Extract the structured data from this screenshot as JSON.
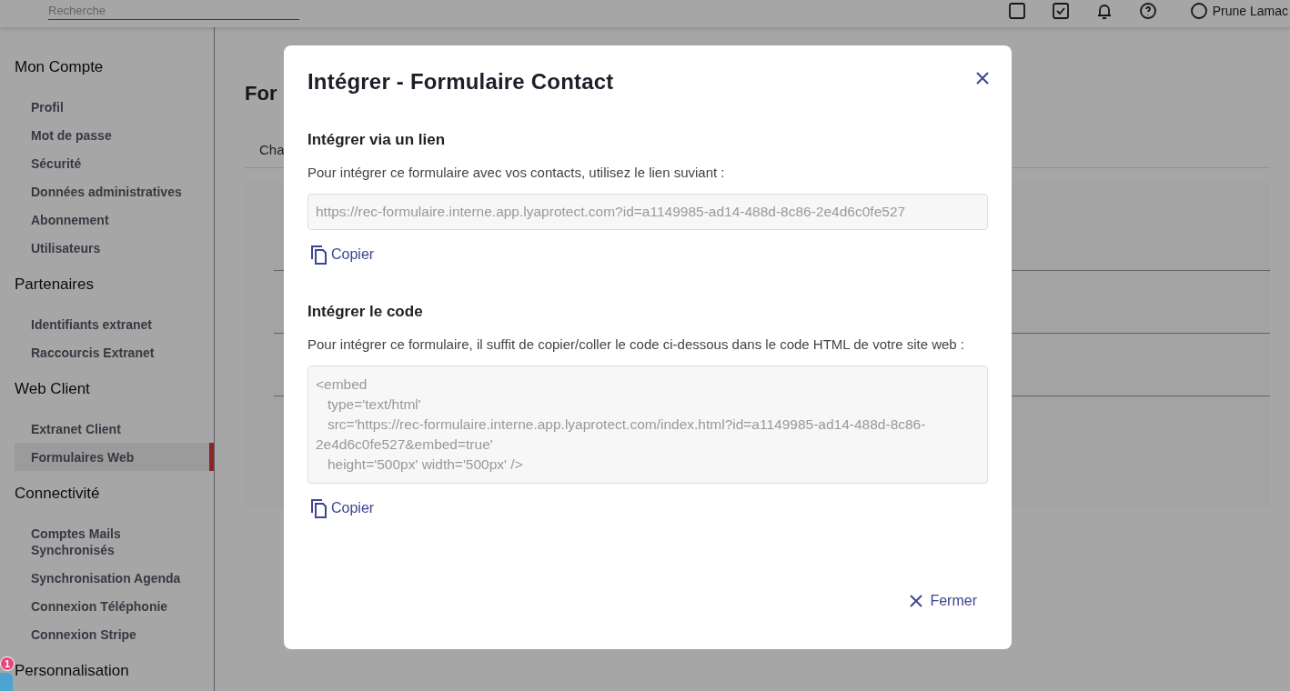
{
  "topbar": {
    "search": {
      "placeholder": "Recherche"
    },
    "user_name": "Prune Lamac"
  },
  "sidebar": {
    "sections": [
      {
        "title": "Mon Compte",
        "items": [
          {
            "label": "Profil",
            "selected": false
          },
          {
            "label": "Mot de passe",
            "selected": false
          },
          {
            "label": "Sécurité",
            "selected": false
          },
          {
            "label": "Données administratives",
            "selected": false
          },
          {
            "label": "Abonnement",
            "selected": false
          },
          {
            "label": "Utilisateurs",
            "selected": false
          }
        ]
      },
      {
        "title": "Partenaires",
        "items": [
          {
            "label": "Identifiants extranet",
            "selected": false
          },
          {
            "label": "Raccourcis Extranet",
            "selected": false
          }
        ]
      },
      {
        "title": "Web Client",
        "items": [
          {
            "label": "Extranet Client",
            "selected": false
          },
          {
            "label": "Formulaires Web",
            "selected": true
          }
        ]
      },
      {
        "title": "Connectivité",
        "items": [
          {
            "label": "Comptes Mails Synchronisés",
            "selected": false
          },
          {
            "label": "Synchronisation Agenda",
            "selected": false
          },
          {
            "label": "Connexion Téléphonie",
            "selected": false
          },
          {
            "label": "Connexion Stripe",
            "selected": false
          }
        ]
      },
      {
        "title": "Personnalisation"
      }
    ]
  },
  "content": {
    "title": "For",
    "tab": "Cha"
  },
  "notification_badge": "1",
  "modal": {
    "title": "Intégrer - Formulaire Contact",
    "sections": [
      {
        "kind": "field",
        "title": "Intégrer via un lien",
        "description": "Pour intégrer ce formulaire avec vos contacts, utilisez le lien suviant :",
        "value": "https://rec-formulaire.interne.app.lyaprotect.com?id=a1149985-ad14-488d-8c86-2e4d6c0fe527",
        "copy_label": "Copier"
      },
      {
        "kind": "code",
        "title": "Intégrer le code",
        "description": "Pour intégrer ce formulaire, il suffit de copier/coller le code ci-dessous dans le code HTML de votre site web :",
        "value": "<embed\n   type='text/html'\n   src='https://rec-formulaire.interne.app.lyaprotect.com/index.html?id=a1149985-ad14-488d-8c86-2e4d6c0fe527&embed=true'\n   height='500px' width='500px' />",
        "copy_label": "Copier"
      }
    ],
    "close_label": "Fermer"
  }
}
